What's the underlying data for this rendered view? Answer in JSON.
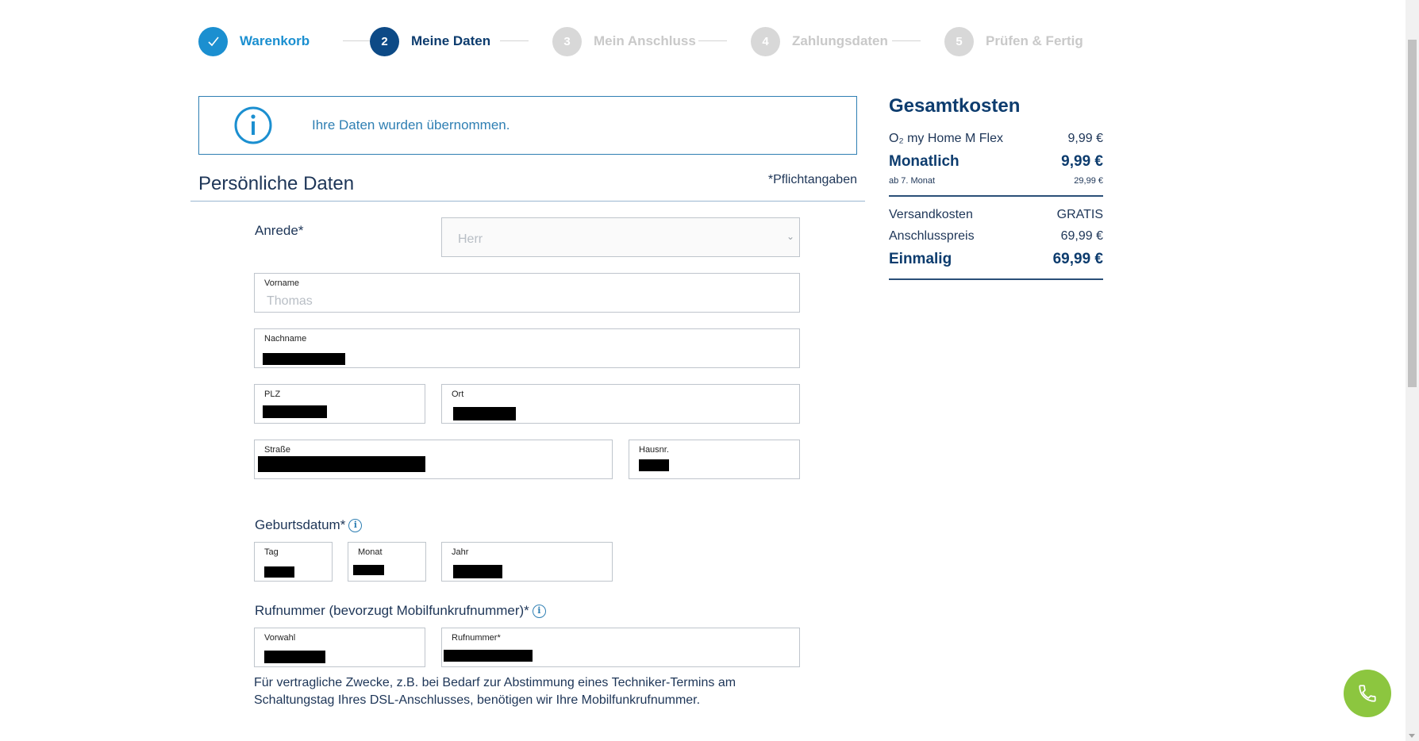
{
  "stepper": {
    "steps": [
      {
        "number": "",
        "label": "Warenkorb",
        "state": "done"
      },
      {
        "number": "2",
        "label": "Meine Daten",
        "state": "active"
      },
      {
        "number": "3",
        "label": "Mein Anschluss",
        "state": "todo"
      },
      {
        "number": "4",
        "label": "Zahlungsdaten",
        "state": "todo"
      },
      {
        "number": "5",
        "label": "Prüfen & Fertig",
        "state": "todo"
      }
    ]
  },
  "info_banner": {
    "text": "Ihre Daten wurden übernommen."
  },
  "section": {
    "title": "Persönliche Daten",
    "required_note": "*Pflichtangaben"
  },
  "form": {
    "anrede": {
      "label": "Anrede*",
      "value": "Herr"
    },
    "vorname": {
      "label": "Vorname",
      "value": "Thomas"
    },
    "nachname": {
      "label": "Nachname"
    },
    "plz": {
      "label": "PLZ"
    },
    "ort": {
      "label": "Ort"
    },
    "strasse": {
      "label": "Straße"
    },
    "hausnr": {
      "label": "Hausnr."
    },
    "geburtsdatum": {
      "label": "Geburtsdatum*",
      "tag": "Tag",
      "monat": "Monat",
      "jahr": "Jahr"
    },
    "rufnummer": {
      "label": "Rufnummer (bevorzugt Mobilfunkrufnummer)*",
      "vorwahl": "Vorwahl",
      "nummer": "Rufnummer*",
      "help": "Für vertragliche Zwecke, z.B. bei Bedarf zur Abstimmung eines Techniker-Termins am Schaltungstag Ihres DSL-Anschlusses, benötigen wir Ihre Mobilfunkrufnummer."
    }
  },
  "costs": {
    "title": "Gesamtkosten",
    "product": {
      "name": "O₂ my Home M Flex",
      "price": "9,99 €"
    },
    "monthly": {
      "label": "Monatlich",
      "price": "9,99 €"
    },
    "after": {
      "label": "ab 7. Monat",
      "price": "29,99 €"
    },
    "shipping": {
      "label": "Versandkosten",
      "price": "GRATIS"
    },
    "connection": {
      "label": "Anschlusspreis",
      "price": "69,99 €"
    },
    "once": {
      "label": "Einmalig",
      "price": "69,99 €"
    }
  },
  "colors": {
    "accent": "#1b8fd0",
    "dark_blue": "#0d3c6e",
    "call_green": "#8cc63f"
  }
}
